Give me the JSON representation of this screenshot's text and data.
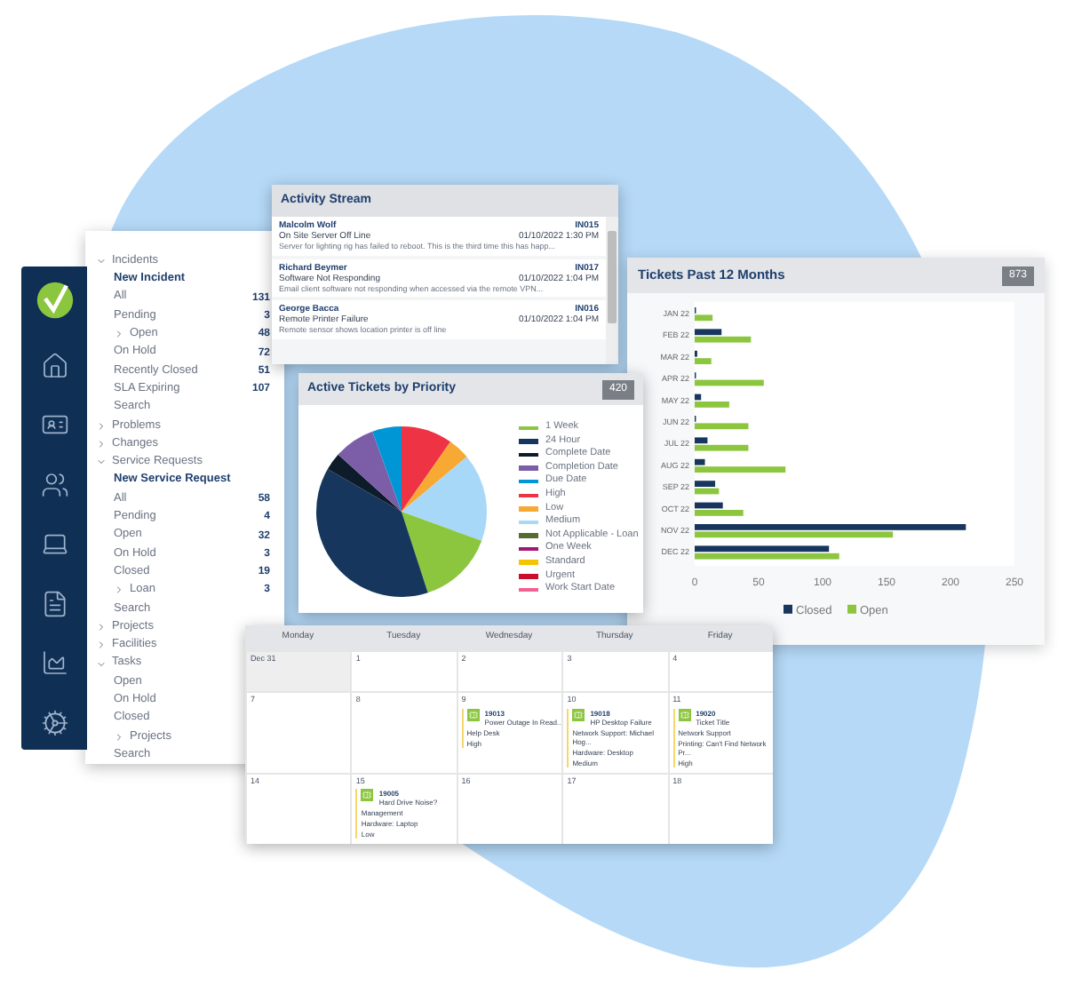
{
  "nav": {
    "sections": [
      {
        "label": "Incidents",
        "expanded": true,
        "children": [
          {
            "label": "New Incident",
            "kind": "action"
          },
          {
            "label": "All",
            "kind": "filter",
            "count": "131"
          },
          {
            "label": "Pending",
            "kind": "filter",
            "count": "3"
          },
          {
            "label": "Open",
            "kind": "group",
            "expanded": false,
            "count": "48"
          },
          {
            "label": "On Hold",
            "kind": "filter",
            "count": "72"
          },
          {
            "label": "Recently Closed",
            "kind": "filter",
            "count": "51"
          },
          {
            "label": "SLA Expiring",
            "kind": "filter",
            "count": "107"
          },
          {
            "label": "Search",
            "kind": "filter"
          }
        ]
      },
      {
        "label": "Problems",
        "expanded": false
      },
      {
        "label": "Changes",
        "expanded": false
      },
      {
        "label": "Service Requests",
        "expanded": true,
        "children": [
          {
            "label": "New Service Request",
            "kind": "action"
          },
          {
            "label": "All",
            "kind": "filter",
            "count": "58"
          },
          {
            "label": "Pending",
            "kind": "filter",
            "count": "4"
          },
          {
            "label": "Open",
            "kind": "filter",
            "count": "32"
          },
          {
            "label": "On Hold",
            "kind": "filter",
            "count": "3"
          },
          {
            "label": "Closed",
            "kind": "filter",
            "count": "19"
          },
          {
            "label": "Loan",
            "kind": "group",
            "expanded": false,
            "count": "3"
          },
          {
            "label": "Search",
            "kind": "filter"
          }
        ]
      },
      {
        "label": "Projects",
        "expanded": false
      },
      {
        "label": "Facilities",
        "expanded": false
      },
      {
        "label": "Tasks",
        "expanded": true,
        "children": [
          {
            "label": "Open",
            "kind": "filter"
          },
          {
            "label": "On Hold",
            "kind": "filter"
          },
          {
            "label": "Closed",
            "kind": "filter"
          },
          {
            "label": "Projects",
            "kind": "group",
            "expanded": false
          },
          {
            "label": "Search",
            "kind": "filter"
          }
        ]
      }
    ]
  },
  "activity_stream": {
    "title": "Activity Stream",
    "entries": [
      {
        "name": "Malcolm Wolf",
        "id": "IN015",
        "subject": "On Site Server Off Line",
        "time": "01/10/2022 1:30 PM",
        "text": "Server for lighting rig has failed to reboot. This is the third time this has happ..."
      },
      {
        "name": "Richard Beymer",
        "id": "IN017",
        "subject": "Software Not Responding",
        "time": "01/10/2022 1:04 PM",
        "text": "Email client software not responding when accessed via the remote VPN..."
      },
      {
        "name": "George Bacca",
        "id": "IN016",
        "subject": "Remote Printer Failure",
        "time": "01/10/2022 1:04 PM",
        "text": "Remote sensor shows location printer is off line"
      }
    ]
  },
  "tickets_chart": {
    "title": "Tickets Past 12 Months",
    "total": "873",
    "chart_data": {
      "type": "bar",
      "orientation": "horizontal",
      "categories": [
        "JAN 22",
        "FEB 22",
        "MAR 22",
        "APR 22",
        "MAY 22",
        "JUN 22",
        "JUL 22",
        "AUG 22",
        "SEP 22",
        "OCT 22",
        "NOV 22",
        "DEC 22"
      ],
      "series": [
        {
          "name": "Closed",
          "color": "#17365d",
          "values": [
            1,
            21,
            2,
            1,
            5,
            1,
            10,
            8,
            16,
            22,
            212,
            105
          ]
        },
        {
          "name": "Open",
          "color": "#8cc63f",
          "values": [
            14,
            44,
            13,
            54,
            27,
            42,
            42,
            71,
            19,
            38,
            155,
            113
          ]
        }
      ],
      "legend": "bottom",
      "xlim": [
        0,
        250
      ],
      "xticks": [
        0,
        50,
        100,
        150,
        200,
        250
      ]
    }
  },
  "priority_chart": {
    "title": "Active Tickets by Priority",
    "total": "420",
    "legend": [
      {
        "label": "1 Week",
        "color": "#8cc63f"
      },
      {
        "label": "24 Hour",
        "color": "#17365d"
      },
      {
        "label": "Complete Date",
        "color": "#0d1b2a"
      },
      {
        "label": "Completion Date",
        "color": "#7b5ea7"
      },
      {
        "label": "Due Date",
        "color": "#0096d6"
      },
      {
        "label": "High",
        "color": "#ee3344"
      },
      {
        "label": "Low",
        "color": "#f7a933"
      },
      {
        "label": "Medium",
        "color": "#a8d8f8"
      },
      {
        "label": "Not Applicable - Loan",
        "color": "#556b2f"
      },
      {
        "label": "One Week",
        "color": "#a0177a"
      },
      {
        "label": "Standard",
        "color": "#f5c400"
      },
      {
        "label": "Urgent",
        "color": "#c8102e"
      },
      {
        "label": "Work Start Date",
        "color": "#f06292"
      }
    ]
  },
  "calendar": {
    "days": [
      "Monday",
      "Tuesday",
      "Wednesday",
      "Thursday",
      "Friday"
    ],
    "weeks": [
      {
        "days": [
          {
            "date": "Dec 31",
            "muted": true
          },
          {
            "date": "1",
            "muted": false
          },
          {
            "date": "2",
            "muted": false
          },
          {
            "date": "3",
            "muted": false
          },
          {
            "date": "4",
            "muted": false
          }
        ]
      },
      {
        "days": [
          {
            "date": "7",
            "muted": false
          },
          {
            "date": "8",
            "muted": false
          },
          {
            "date": "9",
            "muted": false,
            "events": [
              {
                "id": "19013",
                "title": "Power Outage In Read...",
                "lines": [
                  "Help Desk",
                  "High"
                ]
              }
            ]
          },
          {
            "date": "10",
            "muted": false,
            "events": [
              {
                "id": "19018",
                "title": "HP Desktop Failure",
                "lines": [
                  "Network Support: Michael Hog...",
                  "Hardware: Desktop",
                  "Medium"
                ]
              }
            ]
          },
          {
            "date": "11",
            "muted": false,
            "events": [
              {
                "id": "19020",
                "title": "Ticket Title",
                "lines": [
                  "Network Support",
                  "Printing: Can't Find Network Pr...",
                  "High"
                ]
              }
            ]
          }
        ]
      },
      {
        "days": [
          {
            "date": "14",
            "muted": false
          },
          {
            "date": "15",
            "muted": false,
            "events": [
              {
                "id": "19005",
                "title": "Hard Drive Noise?",
                "lines": [
                  "Management",
                  "Hardware: Laptop",
                  "Low"
                ]
              }
            ]
          },
          {
            "date": "16",
            "muted": false
          },
          {
            "date": "17",
            "muted": false
          },
          {
            "date": "18",
            "muted": false
          }
        ]
      }
    ]
  }
}
